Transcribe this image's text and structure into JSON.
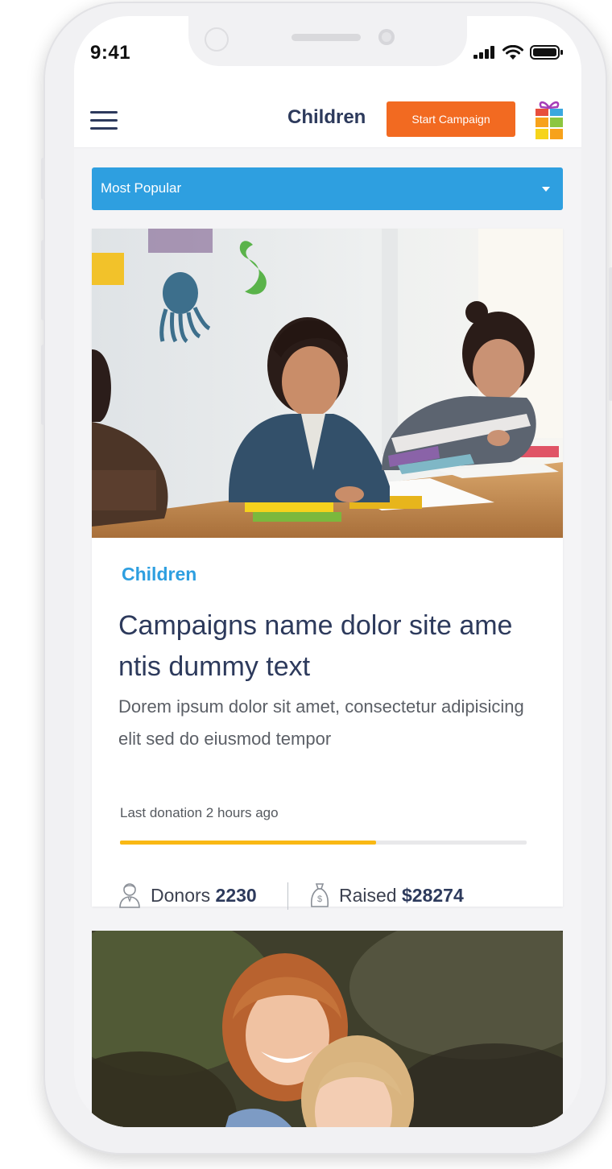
{
  "status_bar": {
    "time": "9:41"
  },
  "header": {
    "title": "Children",
    "start_button_label": "Start Campaign",
    "menu_icon": "hamburger-menu-icon",
    "logo_icon": "gift-logo-icon"
  },
  "sort": {
    "selected": "Most Popular"
  },
  "campaigns": [
    {
      "category": "Children",
      "title": "Campaigns name dolor site ame ntis dummy text",
      "description": "Dorem ipsum dolor sit amet, consectetur adipisicing elit sed do eiusmod tempor",
      "last_donation": "Last donation 2 hours ago",
      "progress": 0.63,
      "donors_label": "Donors",
      "donors_value": "2230",
      "raised_label": "Raised",
      "raised_value": "$28274"
    }
  ],
  "colors": {
    "accent_blue": "#2e9fe0",
    "button_orange": "#f26a21",
    "navy_text": "#2d3a5c",
    "progress_yellow": "#f9b814"
  }
}
